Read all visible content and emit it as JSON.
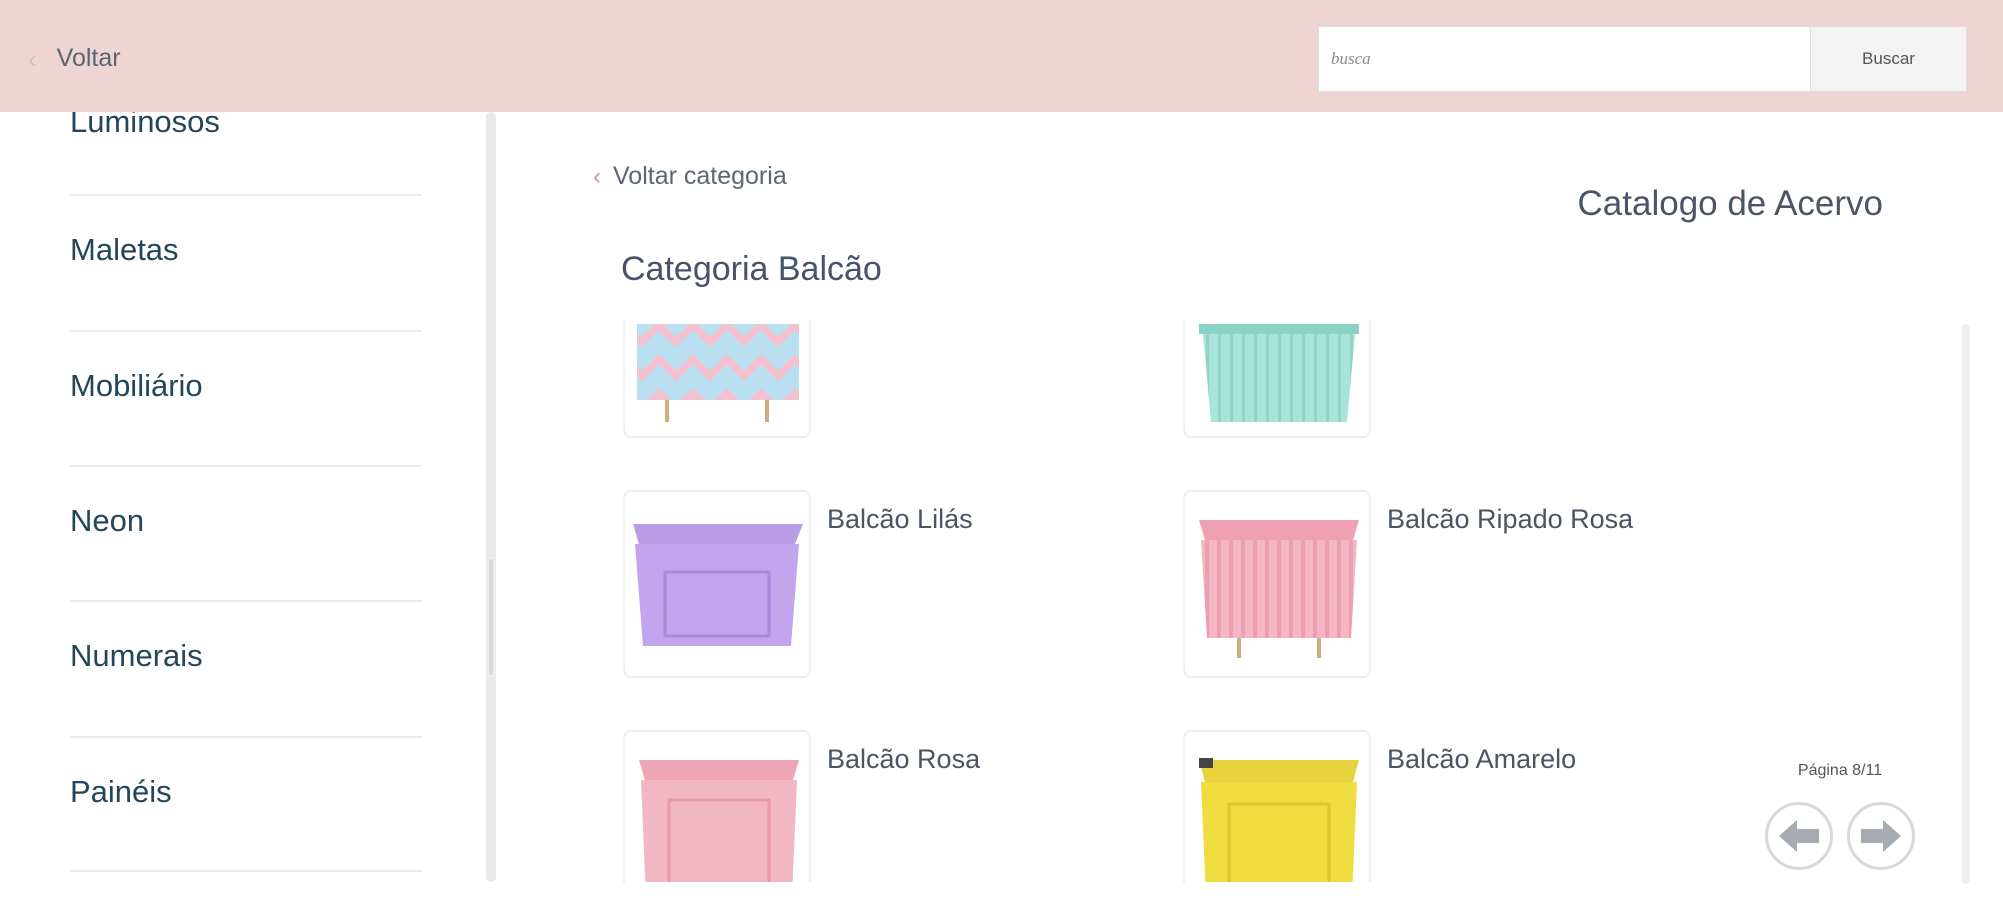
{
  "header": {
    "back_label": "Voltar",
    "search_placeholder": "busca",
    "search_button": "Buscar"
  },
  "sidebar": {
    "items": [
      {
        "label": "Luminosos"
      },
      {
        "label": "Maletas"
      },
      {
        "label": "Mobiliário"
      },
      {
        "label": "Neon"
      },
      {
        "label": "Numerais"
      },
      {
        "label": "Painéis"
      }
    ]
  },
  "main": {
    "back_category": "Voltar categoria",
    "catalog_title": "Catalogo de Acervo",
    "category_title": "Categoria Balcão",
    "products": [
      {
        "name": ""
      },
      {
        "name": ""
      },
      {
        "name": "Balcão Lilás"
      },
      {
        "name": "Balcão Ripado Rosa"
      },
      {
        "name": "Balcão Rosa"
      },
      {
        "name": "Balcão Amarelo"
      }
    ],
    "pagination": {
      "label": "Página 8/11"
    }
  },
  "colors": {
    "topbar": "#efd4d4",
    "accent": "#e08a96",
    "text": "#3e4a5b",
    "sidebar_text": "#24465a"
  },
  "icons": {
    "back": "chevron-left-icon",
    "prev": "arrow-left-icon",
    "next": "arrow-right-icon"
  }
}
